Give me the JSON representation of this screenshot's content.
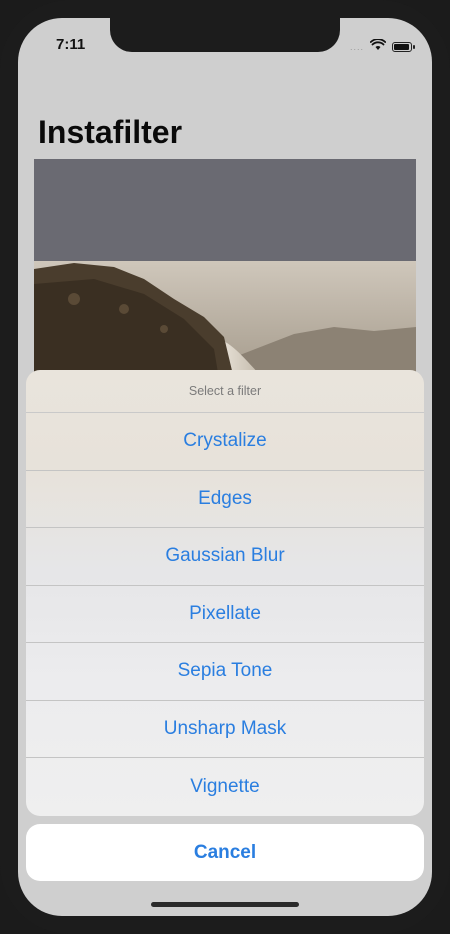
{
  "status_bar": {
    "time": "7:11",
    "signal": "....",
    "icons": [
      "wifi-icon",
      "battery-icon"
    ]
  },
  "app": {
    "title": "Instafilter"
  },
  "action_sheet": {
    "header": "Select a filter",
    "options": [
      {
        "label": "Crystalize"
      },
      {
        "label": "Edges"
      },
      {
        "label": "Gaussian Blur"
      },
      {
        "label": "Pixellate"
      },
      {
        "label": "Sepia Tone"
      },
      {
        "label": "Unsharp Mask"
      },
      {
        "label": "Vignette"
      }
    ],
    "cancel_label": "Cancel"
  },
  "colors": {
    "accent": "#2a7ee0",
    "title": "#0a0a0a"
  }
}
